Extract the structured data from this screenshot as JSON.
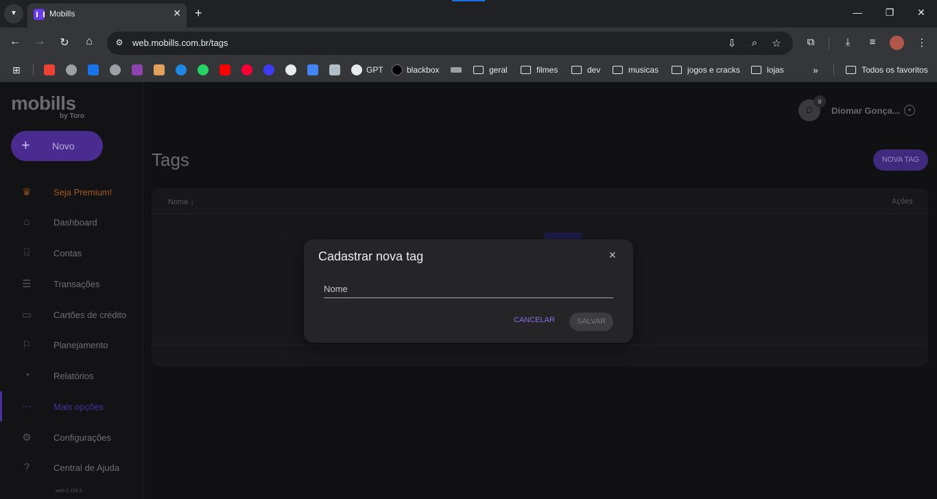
{
  "browser": {
    "tab_title": "Mobills",
    "url": "web.mobills.com.br/tags",
    "bookmarks": {
      "gpt": "GPT",
      "blackbox": "blackbox",
      "folders": [
        "geral",
        "filmes",
        "dev",
        "musicas",
        "jogos e cracks",
        "lojas"
      ],
      "all_favorites": "Todos os favoritos"
    }
  },
  "app": {
    "logo": "mobills",
    "logo_sub": "by Toro",
    "new_button": "Novo",
    "nav": [
      {
        "label": "Seja Premium!",
        "icon": "crown-icon",
        "color": "#a35a1f"
      },
      {
        "label": "Dashboard",
        "icon": "home-icon"
      },
      {
        "label": "Contas",
        "icon": "bank-icon"
      },
      {
        "label": "Transações",
        "icon": "list-icon"
      },
      {
        "label": "Cartões de crédito",
        "icon": "credit-card-icon"
      },
      {
        "label": "Planejamento",
        "icon": "flag-icon"
      },
      {
        "label": "Relatórios",
        "icon": "pie-chart-icon"
      },
      {
        "label": "Mais opções",
        "icon": "more-icon",
        "color": "#4a2fa0"
      },
      {
        "label": "Configurações",
        "icon": "gear-icon"
      },
      {
        "label": "Central de Ajuda",
        "icon": "help-icon"
      }
    ],
    "version": "web-2.153.2",
    "user": {
      "initial": "D",
      "name": "Diomar Gonça..."
    },
    "page_title": "Tags",
    "new_tag_button": "NOVA TAG",
    "table": {
      "col_name": "Nome",
      "col_actions": "Ações"
    }
  },
  "modal": {
    "title": "Cadastrar nova tag",
    "name_placeholder": "Nome",
    "cancel": "CANCELAR",
    "save": "SALVAR"
  },
  "colors": {
    "accent": "#6a3cf0",
    "premium": "#a35a1f",
    "more_options": "#4a2fa0"
  }
}
